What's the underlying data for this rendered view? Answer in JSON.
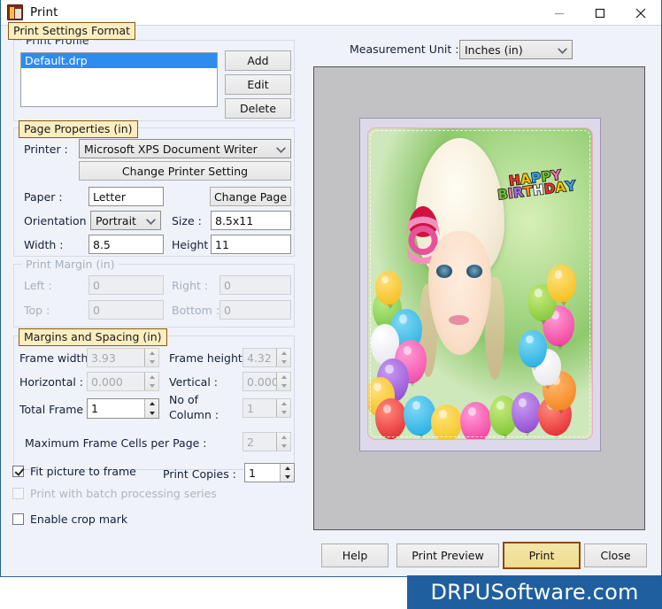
{
  "window": {
    "title": "Print",
    "icon": "app-print-icon",
    "minimize": "–",
    "maximize": "□",
    "close": "✕"
  },
  "tab_label": "Print Settings Format",
  "profile_group": {
    "title": "Print Profile",
    "items": [
      "Default.drp"
    ],
    "selected_index": 0,
    "buttons": {
      "add": "Add",
      "edit": "Edit",
      "delete": "Delete"
    }
  },
  "page_properties": {
    "label": "Page Properties  (in)",
    "printer_label": "Printer :",
    "printer_value": "Microsoft XPS Document Writer",
    "change_printer_setting": "Change Printer Setting",
    "paper_label": "Paper :",
    "paper_value": "Letter",
    "change_page": "Change Page",
    "orientation_label": "Orientation :",
    "orientation_value": "Portrait",
    "size_label": "Size :",
    "size_value": "8.5x11",
    "width_label": "Width :",
    "width_value": "8.5",
    "height_label": "Height :",
    "height_value": "11"
  },
  "print_margin": {
    "title": "Print Margin (in)",
    "left_label": "Left :",
    "left_value": "0",
    "right_label": "Right :",
    "right_value": "0",
    "top_label": "Top :",
    "top_value": "0",
    "bottom_label": "Bottom :",
    "bottom_value": "0"
  },
  "margins_spacing": {
    "label": "Margins and Spacing  (in)",
    "frame_width_label": "Frame width",
    "frame_width_value": "3.93",
    "frame_height_label": "Frame height :",
    "frame_height_value": "4.32",
    "horizontal_label": "Horizontal :",
    "horizontal_value": "0.000",
    "vertical_label": "Vertical :",
    "vertical_value": "0.000",
    "total_frame_label": "Total Frame",
    "total_frame_value": "1",
    "no_of_column_label": "No of\nColumn :",
    "no_of_column_line1": "No of",
    "no_of_column_line2": "Column :",
    "no_of_column_value": "1",
    "max_cells_label": "Maximum Frame Cells per Page :",
    "max_cells_value": "2"
  },
  "options": {
    "fit_picture_to_frame": "Fit picture to frame",
    "fit_picture_checked": true,
    "batch_processing": "Print with batch processing series",
    "batch_checked": false,
    "crop_mark": "Enable crop mark",
    "crop_checked": false,
    "print_copies_label": "Print Copies :",
    "print_copies_value": "1"
  },
  "preview": {
    "measurement_unit_label": "Measurement Unit :",
    "measurement_unit_value": "Inches (in)",
    "card_text_line1": "HAPPY",
    "card_text_line2": "BIRTHDAY"
  },
  "footer_buttons": {
    "help": "Help",
    "print_preview": "Print Preview",
    "print": "Print",
    "close": "Close"
  },
  "watermark": "DRPUSoftware.com",
  "colors": {
    "dialog_bg": "#eff2f9",
    "accent_label_bg": "#faeec0",
    "accent_label_border": "#8b5a11",
    "selection_blue": "#2e8bef",
    "preview_bg": "#c2c2c4",
    "watermark_bg": "#1f5fa0",
    "window_border": "#2a6496"
  }
}
